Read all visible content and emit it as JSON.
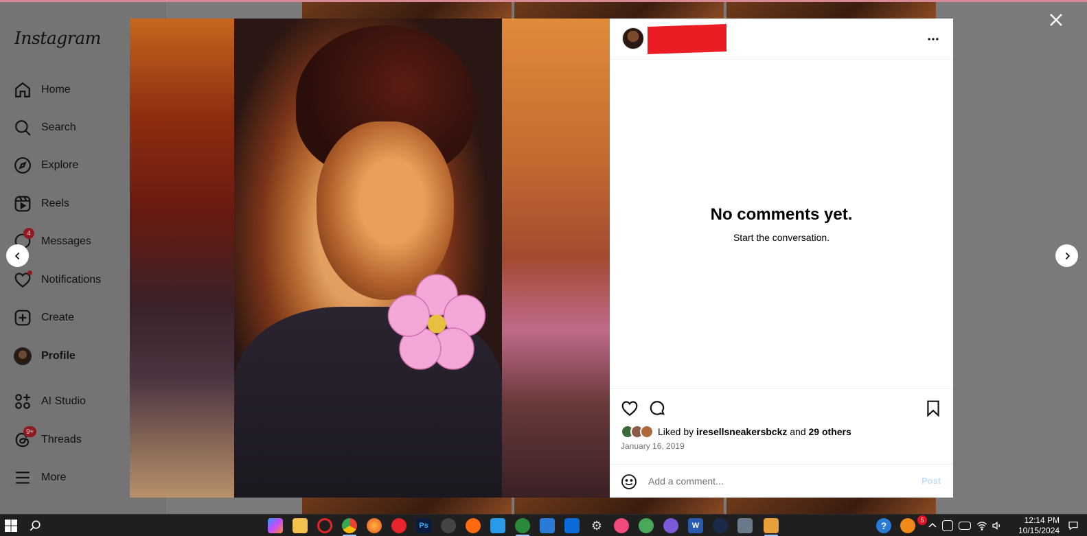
{
  "sidebar": {
    "logo": "Instagram",
    "items": [
      {
        "label": "Home",
        "icon": "home-icon"
      },
      {
        "label": "Search",
        "icon": "search-icon"
      },
      {
        "label": "Explore",
        "icon": "compass-icon"
      },
      {
        "label": "Reels",
        "icon": "reels-icon"
      },
      {
        "label": "Messages",
        "icon": "messenger-icon",
        "badge": "4"
      },
      {
        "label": "Notifications",
        "icon": "heart-icon"
      },
      {
        "label": "Create",
        "icon": "plus-square-icon"
      },
      {
        "label": "Profile",
        "icon": "avatar"
      },
      {
        "label": "AI Studio",
        "icon": "ai-studio-icon"
      },
      {
        "label": "Threads",
        "icon": "threads-icon",
        "badge": "9+"
      },
      {
        "label": "More",
        "icon": "hamburger-icon"
      }
    ]
  },
  "post": {
    "no_comments_title": "No comments yet.",
    "no_comments_subtitle": "Start the conversation.",
    "liked_prefix": "Liked by",
    "liked_user": "iresellsneakersbckz",
    "liked_and": "and",
    "liked_others": "29 others",
    "date": "January 16, 2019",
    "comment_placeholder": "Add a comment...",
    "post_label": "Post"
  },
  "taskbar": {
    "time": "12:14 PM",
    "date": "10/15/2024",
    "tray_badge": "5"
  },
  "colors": {
    "instagram_link_blue": "#c0dffd",
    "badge_red": "#8e1b22",
    "redaction_red": "#ec1c24"
  }
}
